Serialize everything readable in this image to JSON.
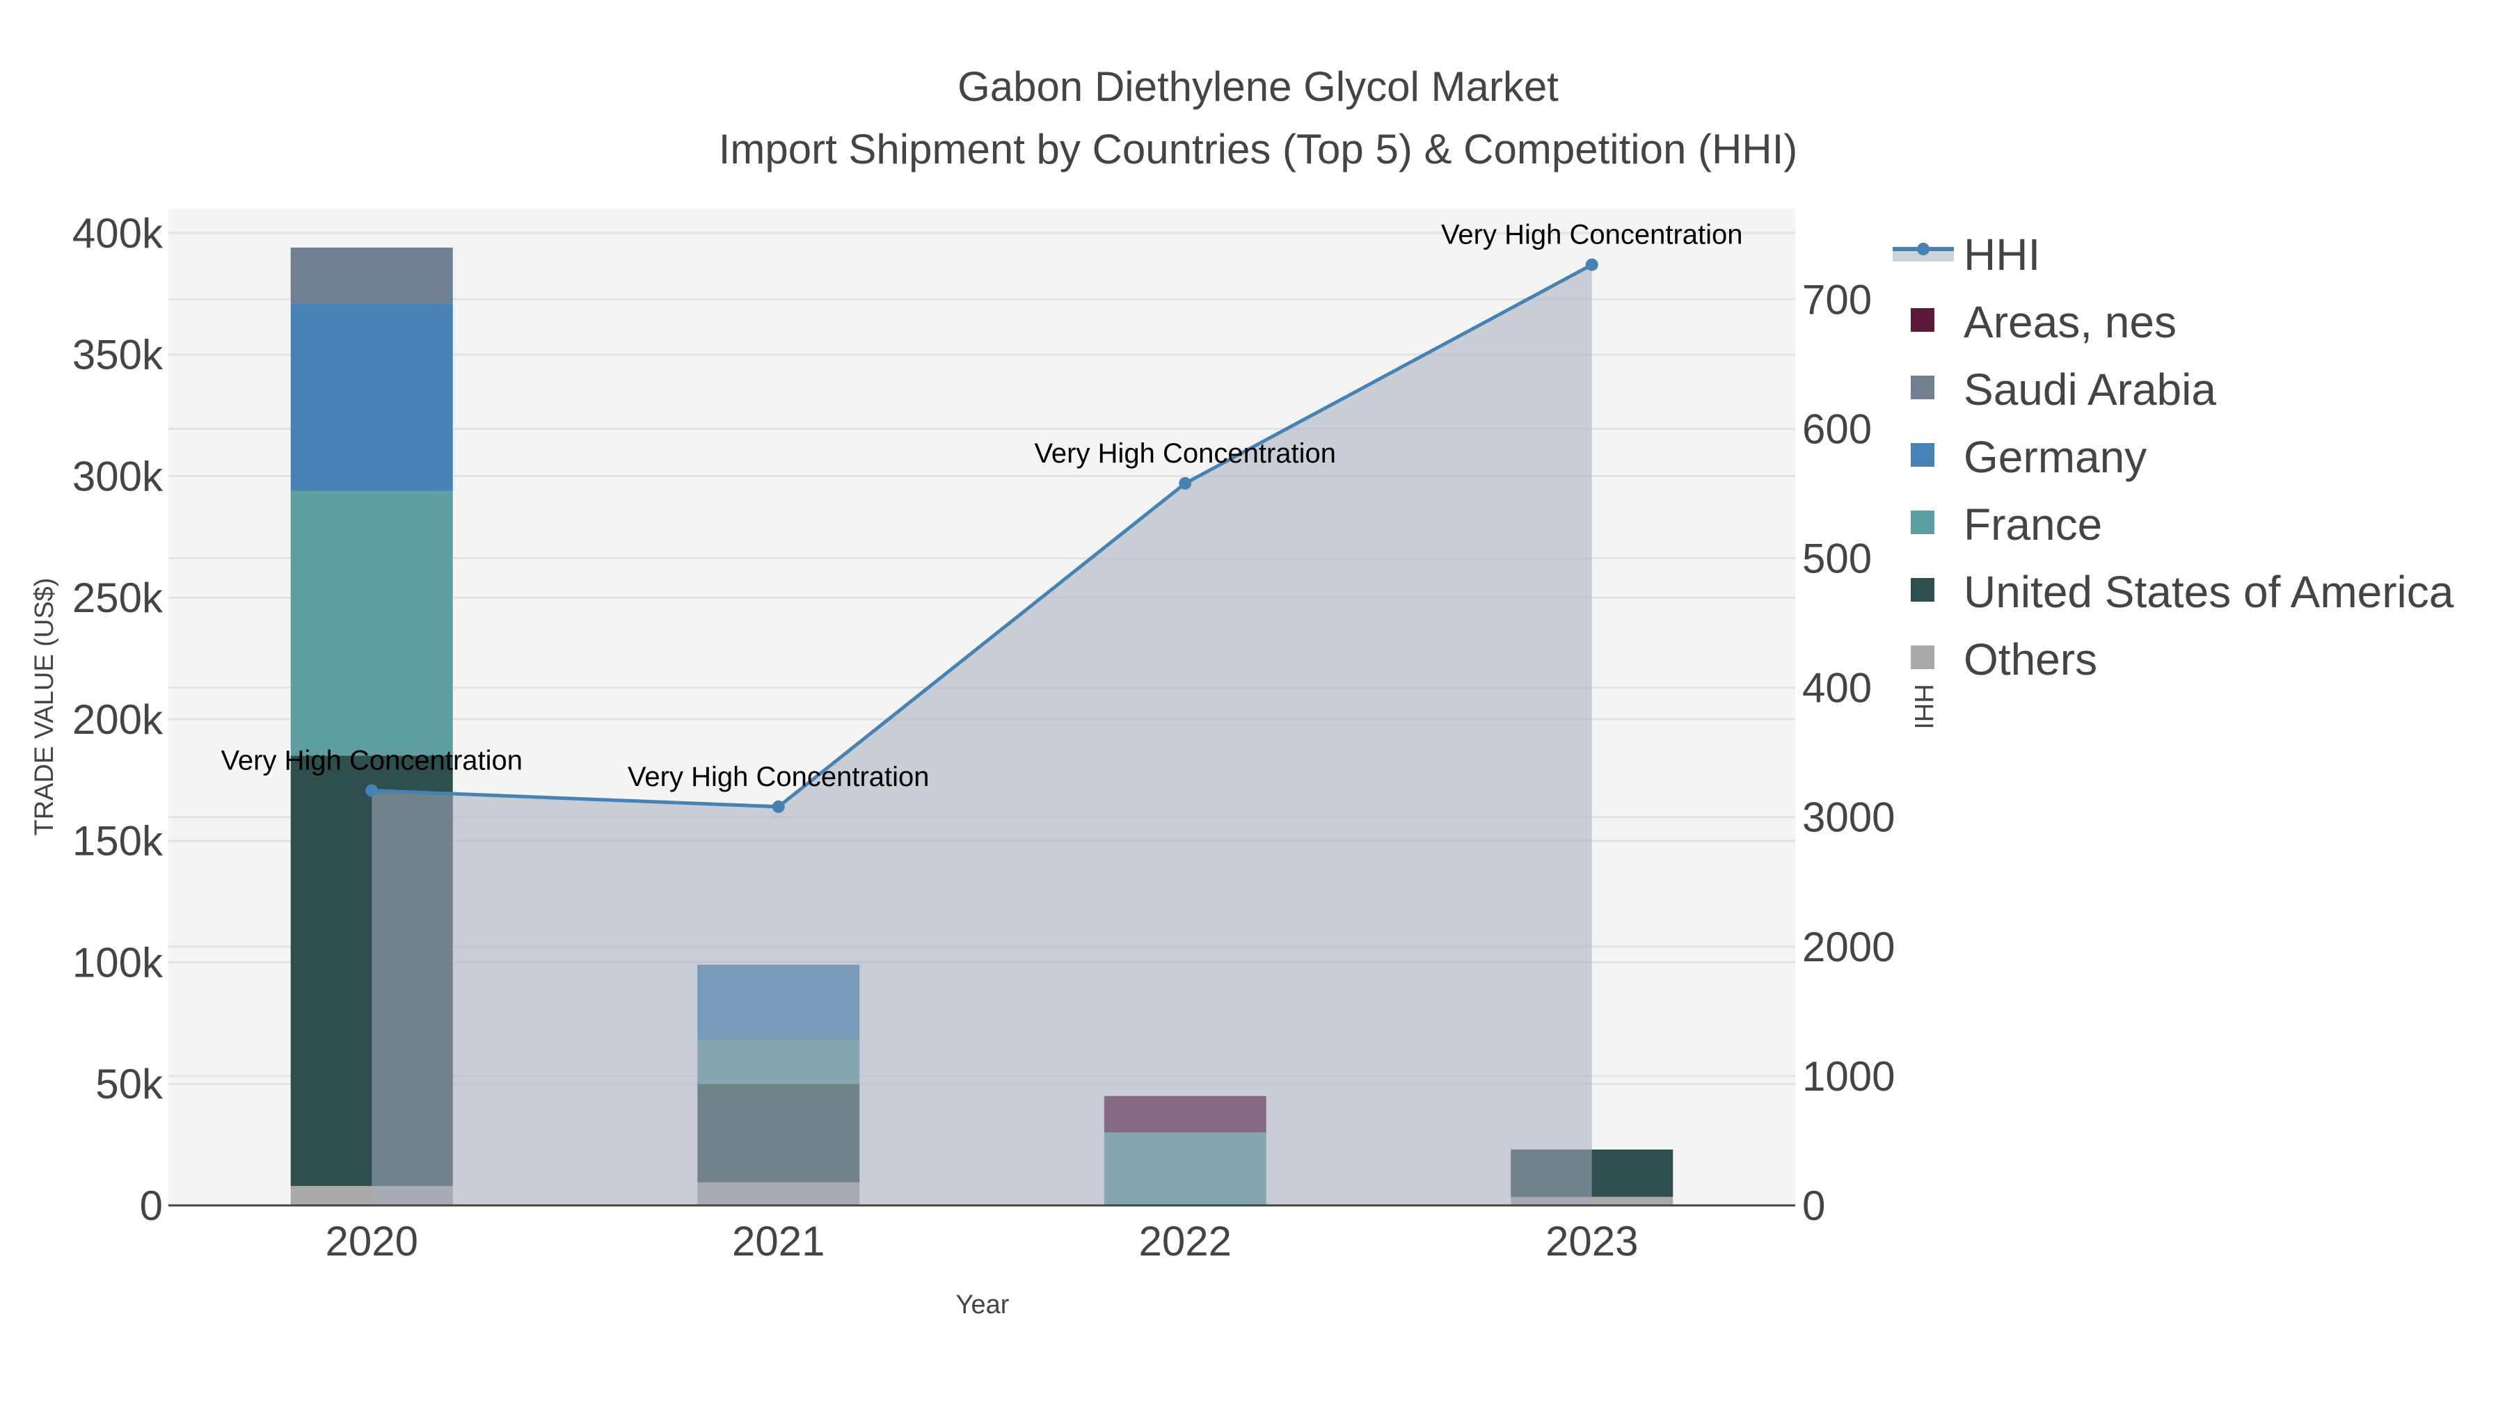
{
  "chart_data": {
    "type": "bar",
    "title": "Gabon Diethylene Glycol Market",
    "subtitle": "Import Shipment by Countries (Top 5) & Competition (HHI)",
    "xlabel": "Year",
    "ylabel": "TRADE VALUE (US$)",
    "y2label": "HHI",
    "categories": [
      "2020",
      "2021",
      "2022",
      "2023"
    ],
    "ylim": [
      0,
      410000
    ],
    "y2lim": [
      0,
      7700
    ],
    "yticks": [
      0,
      50000,
      100000,
      150000,
      200000,
      250000,
      300000,
      350000,
      400000
    ],
    "ytick_labels": [
      "0",
      "50k",
      "100k",
      "150k",
      "200k",
      "250k",
      "300k",
      "350k",
      "400k"
    ],
    "y2ticks": [
      0,
      1000,
      2000,
      3000,
      4000,
      5000,
      6000,
      7000
    ],
    "y2tick_labels": [
      "0",
      "1000",
      "2000",
      "3000",
      "400",
      "500",
      "600",
      "700"
    ],
    "grid": true,
    "legend_position": "right",
    "series": [
      {
        "name": "Others",
        "color": "#a9a9a9",
        "values": [
          8000,
          9500,
          0,
          3500
        ]
      },
      {
        "name": "United States of America",
        "color": "#2f4f4f",
        "values": [
          177000,
          40500,
          0,
          19500
        ]
      },
      {
        "name": "France",
        "color": "#5f9ea0",
        "values": [
          109000,
          18000,
          30000,
          0
        ]
      },
      {
        "name": "Germany",
        "color": "#4682b4",
        "values": [
          77000,
          31000,
          0,
          0
        ]
      },
      {
        "name": "Saudi Arabia",
        "color": "#708090",
        "values": [
          23000,
          0,
          0,
          0
        ]
      },
      {
        "name": "Areas, nes",
        "color": "#5c1a3a",
        "values": [
          0,
          0,
          15000,
          0
        ]
      }
    ],
    "line": {
      "name": "HHI",
      "color": "#4682b4",
      "values": [
        3205,
        3080,
        5578,
        7267
      ],
      "annotations": [
        "Very High Concentration",
        "Very High Concentration",
        "Very High Concentration",
        "Very High Concentration"
      ]
    },
    "legend": [
      "HHI",
      "Areas, nes",
      "Saudi Arabia",
      "Germany",
      "France",
      "United States of America",
      "Others"
    ]
  }
}
